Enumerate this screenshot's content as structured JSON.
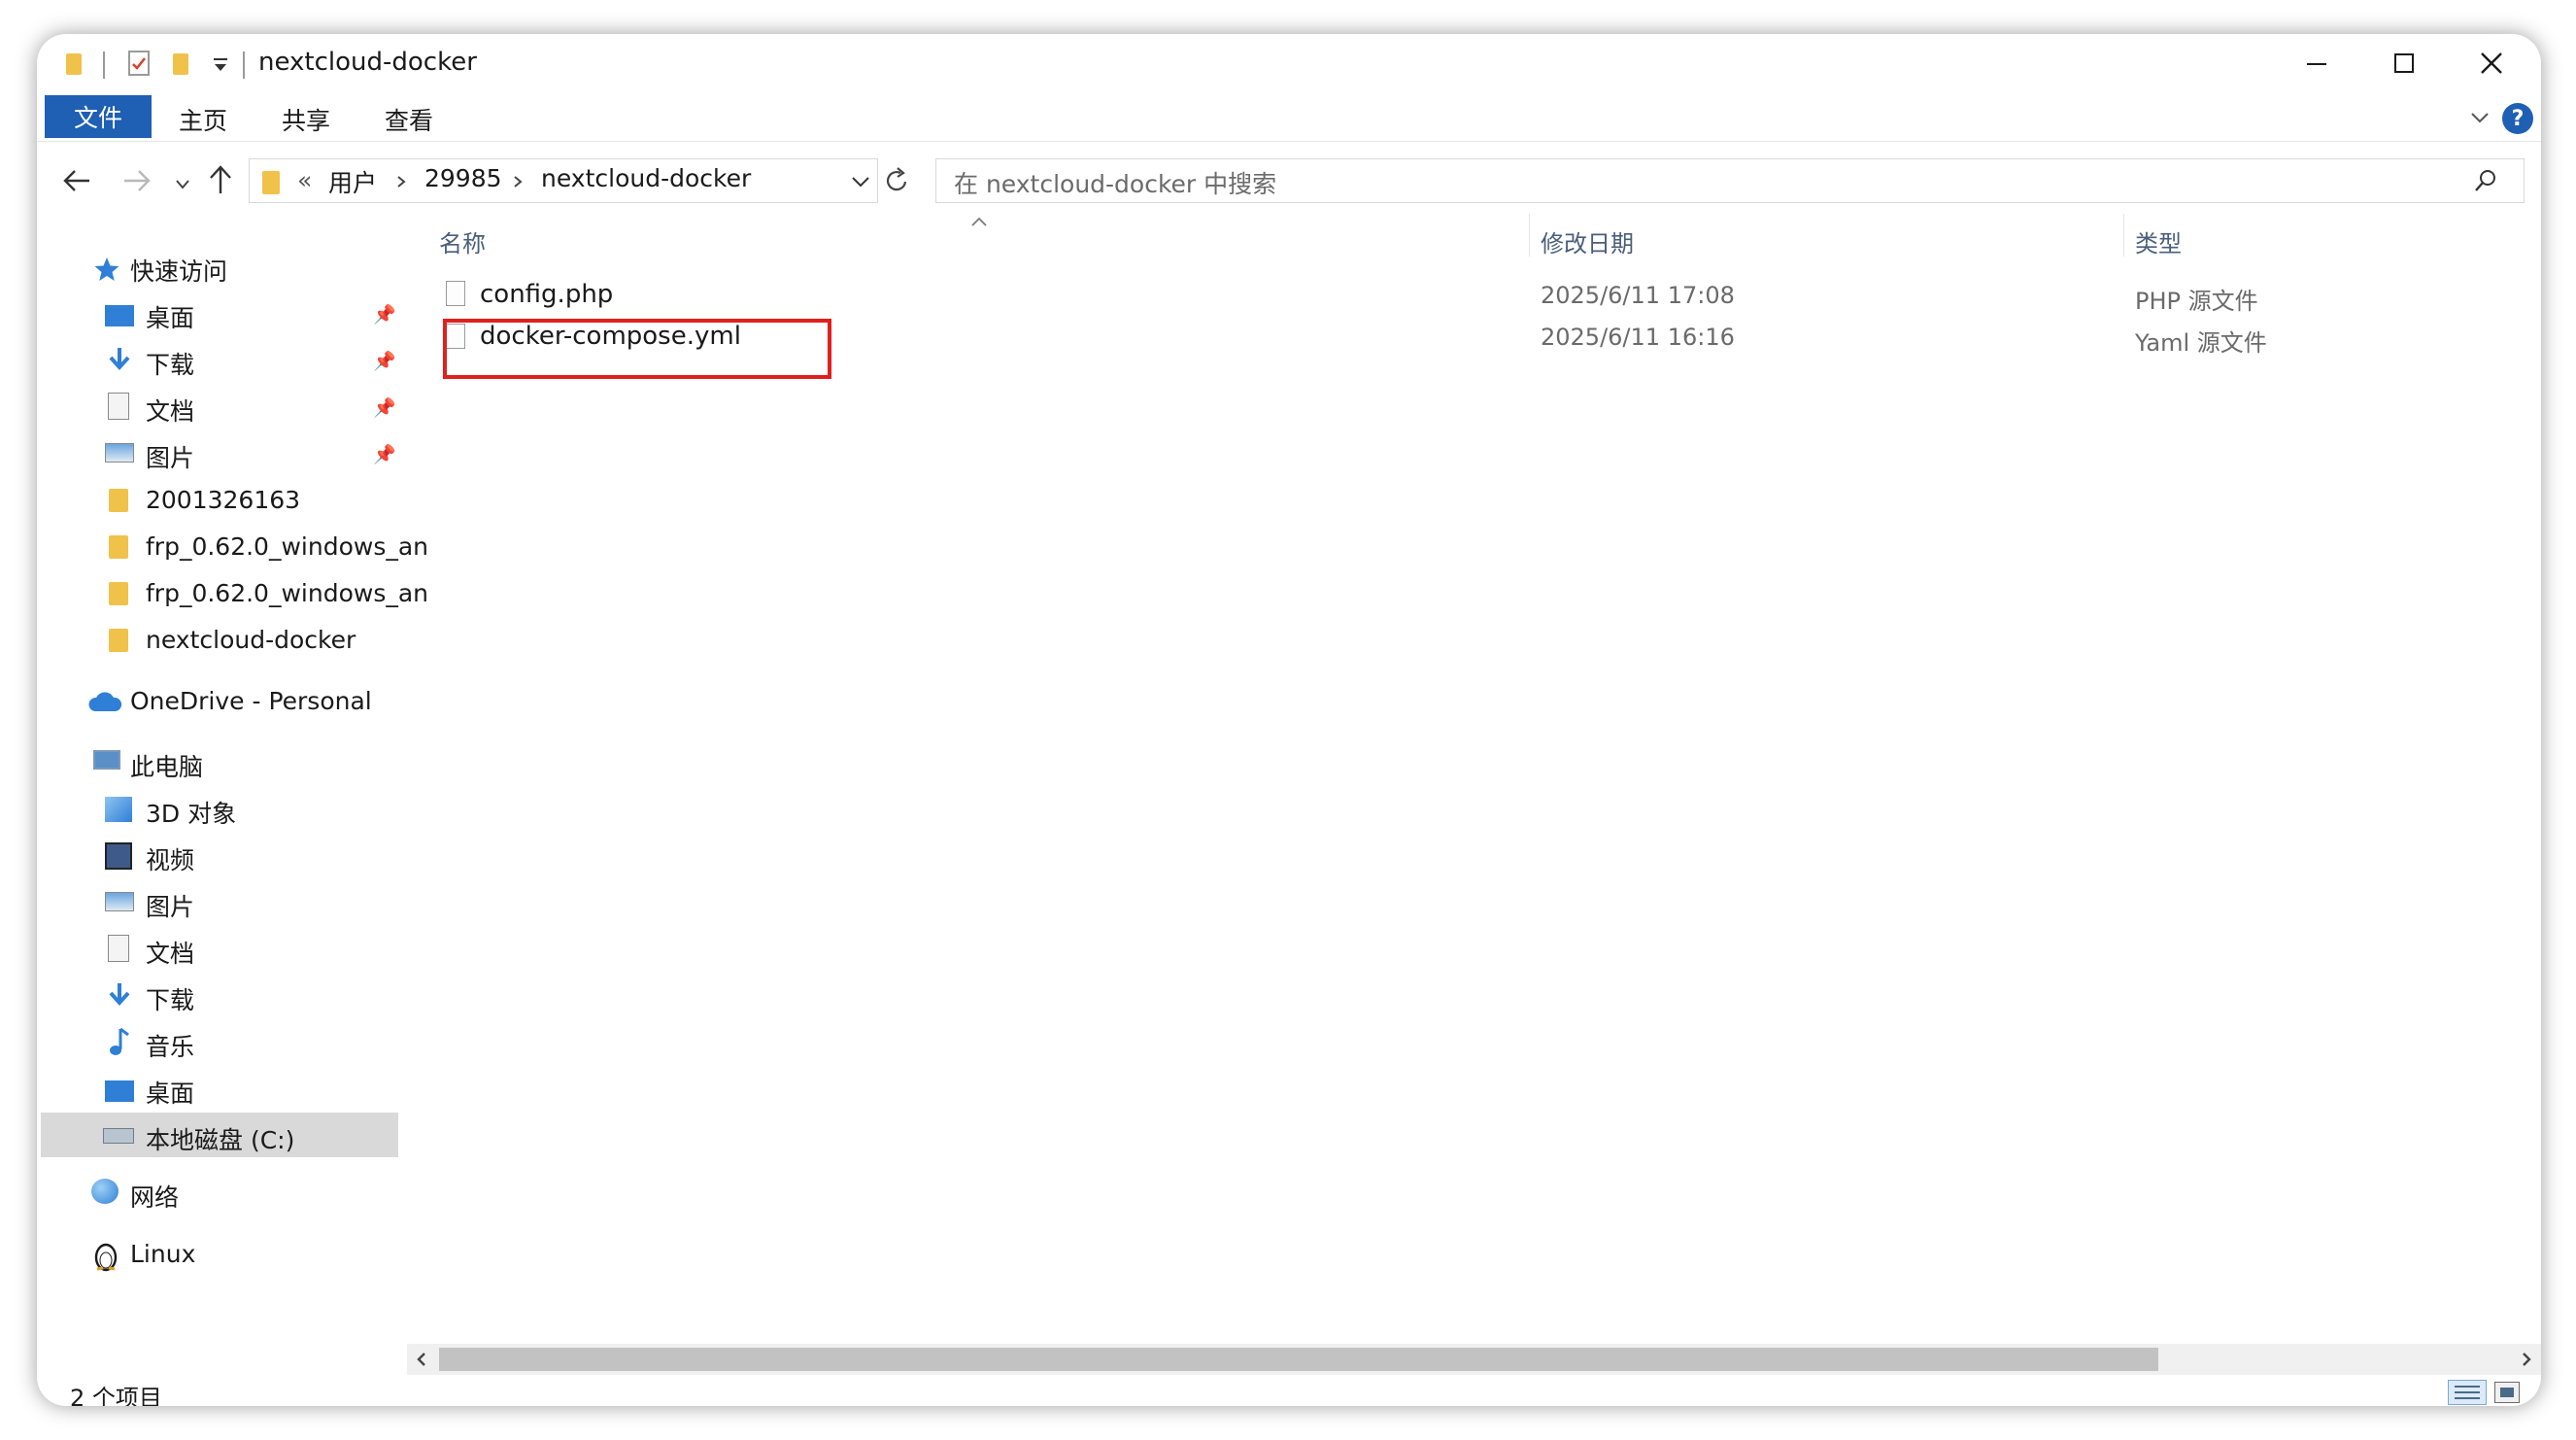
{
  "window": {
    "title": "nextcloud-docker"
  },
  "ribbon": {
    "file_tab": "文件",
    "tabs": [
      "主页",
      "共享",
      "查看"
    ]
  },
  "address": {
    "overflow": "«",
    "crumbs": [
      "用户",
      "29985",
      "nextcloud-docker"
    ]
  },
  "search": {
    "placeholder": "在 nextcloud-docker 中搜索"
  },
  "nav": {
    "quick_access": "快速访问",
    "quick_items": [
      "桌面",
      "下载",
      "文档",
      "图片",
      "2001326163",
      "frp_0.62.0_windows_an",
      "frp_0.62.0_windows_an",
      "nextcloud-docker"
    ],
    "onedrive": "OneDrive - Personal",
    "this_pc": "此电脑",
    "pc_items": [
      "3D 对象",
      "视频",
      "图片",
      "文档",
      "下载",
      "音乐",
      "桌面",
      "本地磁盘 (C:)"
    ],
    "network": "网络",
    "linux": "Linux"
  },
  "columns": {
    "name": "名称",
    "modified": "修改日期",
    "type": "类型"
  },
  "files": [
    {
      "name": "config.php",
      "modified": "2025/6/11 17:08",
      "type": "PHP 源文件"
    },
    {
      "name": "docker-compose.yml",
      "modified": "2025/6/11 16:16",
      "type": "Yaml 源文件"
    }
  ],
  "status": {
    "item_count": "2 个项目"
  },
  "colors": {
    "accent": "#1f5fb4",
    "highlight": "#e0201e",
    "folder": "#f0c24a",
    "selected": "#d9d9d9"
  }
}
